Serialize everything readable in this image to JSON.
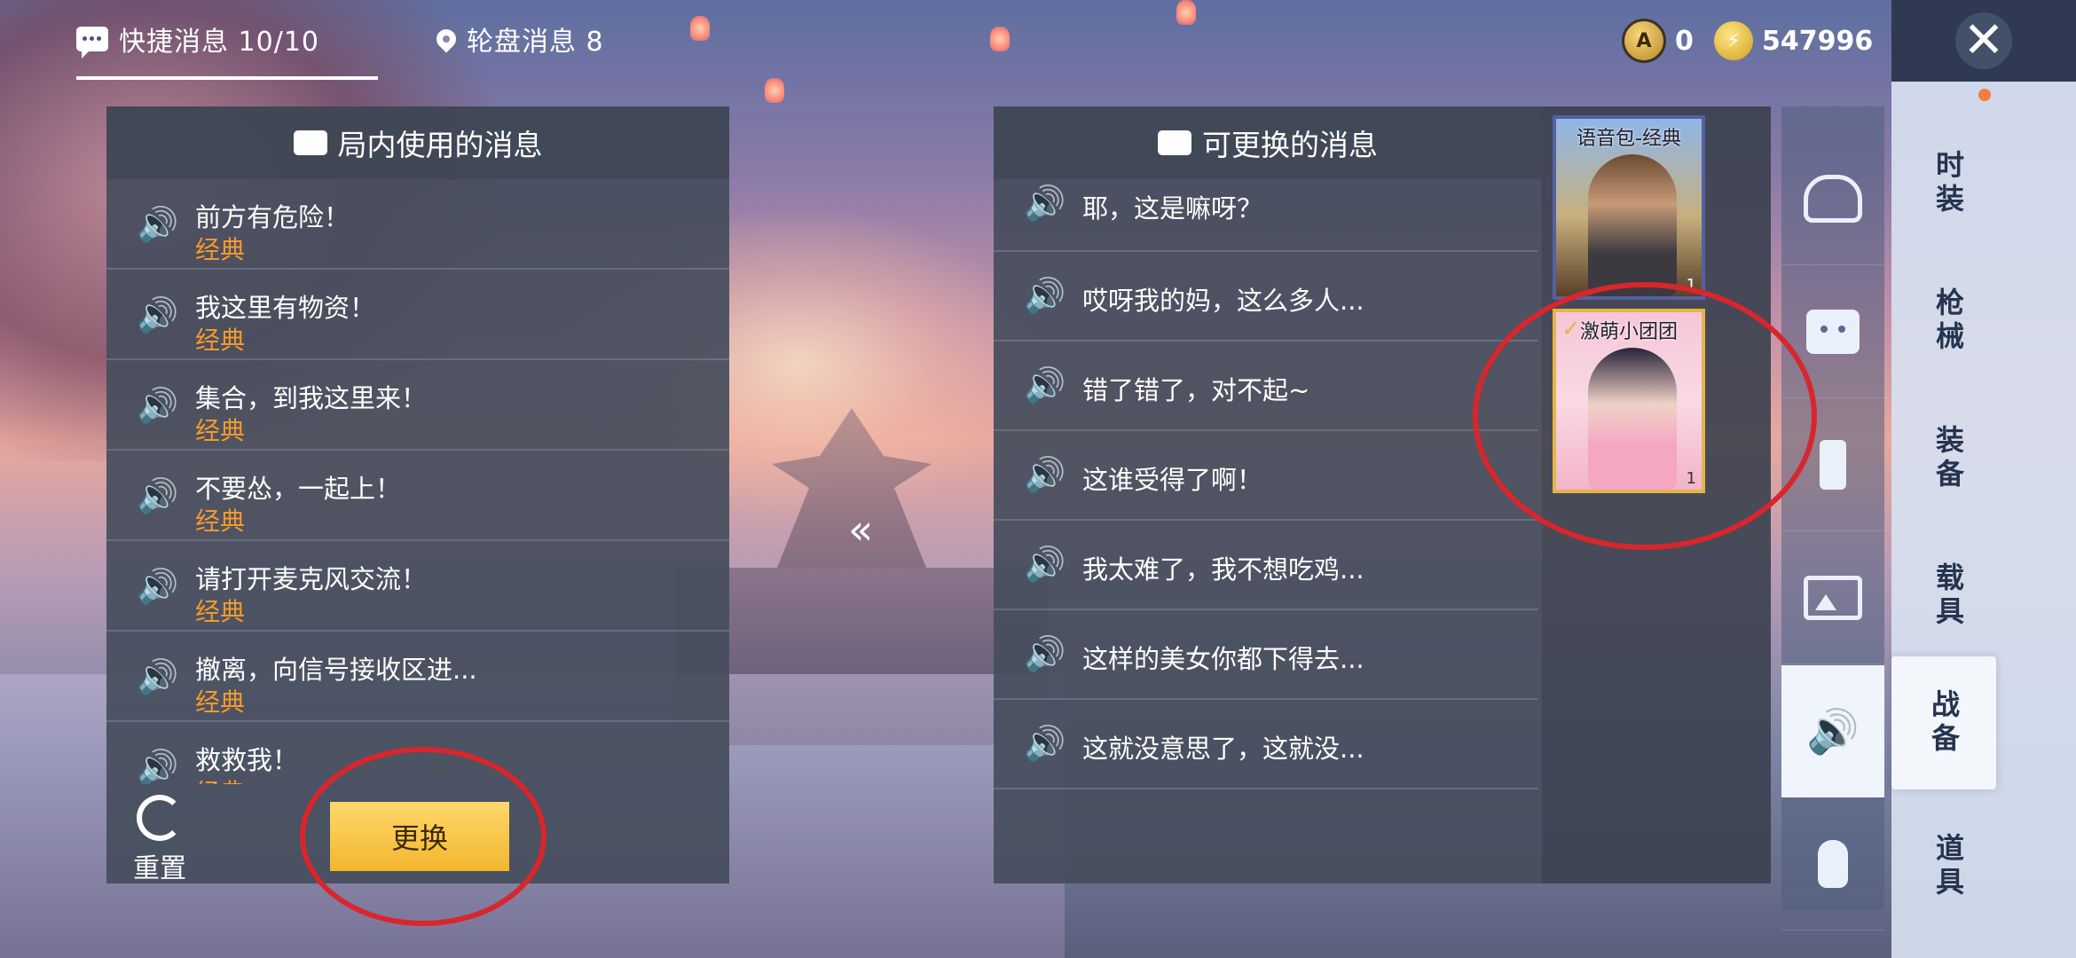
{
  "tabs": [
    {
      "label": "快捷消息 10/10",
      "active": true
    },
    {
      "label": "轮盘消息 8",
      "active": false
    }
  ],
  "currency": [
    {
      "icon": "token-coin-icon",
      "value": "0"
    },
    {
      "icon": "gold-coin-icon",
      "value": "547996"
    }
  ],
  "close_icon": "close-icon",
  "side_nav": [
    "时装",
    "枪械",
    "装备",
    "载具",
    "战备",
    "道具"
  ],
  "side_nav_active": "战备",
  "categories": [
    "robot-icon",
    "emote-icon",
    "spray-icon",
    "photo-icon",
    "voice-icon",
    "tap-icon"
  ],
  "left_panel": {
    "title": "局内使用的消息",
    "items": [
      {
        "text": "前方有危险！",
        "tag": "经典"
      },
      {
        "text": "我这里有物资！",
        "tag": "经典"
      },
      {
        "text": "集合，到我这里来！",
        "tag": "经典"
      },
      {
        "text": "不要怂，一起上！",
        "tag": "经典"
      },
      {
        "text": "请打开麦克风交流！",
        "tag": "经典"
      },
      {
        "text": "撤离，向信号接收区进...",
        "tag": "经典"
      },
      {
        "text": "救救我！",
        "tag": "经典"
      }
    ],
    "reset_label": "重置",
    "swap_label": "更换"
  },
  "right_panel": {
    "title": "可更换的消息",
    "items": [
      "耶，这是嘛呀？",
      "哎呀我的妈，这么多人...",
      "错了错了，对不起~",
      "这谁受得了啊！",
      "我太难了，我不想吃鸡...",
      "这样的美女你都下得去...",
      "这就没意思了，这就没..."
    ]
  },
  "voice_packs": [
    {
      "name": "语音包-经典",
      "count": "1",
      "selected": false
    },
    {
      "name": "激萌小团团",
      "count": "1",
      "selected": true
    }
  ],
  "colors": {
    "accent": "#f39a2c",
    "highlight_ring": "#d8262d",
    "button": "#f2b62e"
  }
}
